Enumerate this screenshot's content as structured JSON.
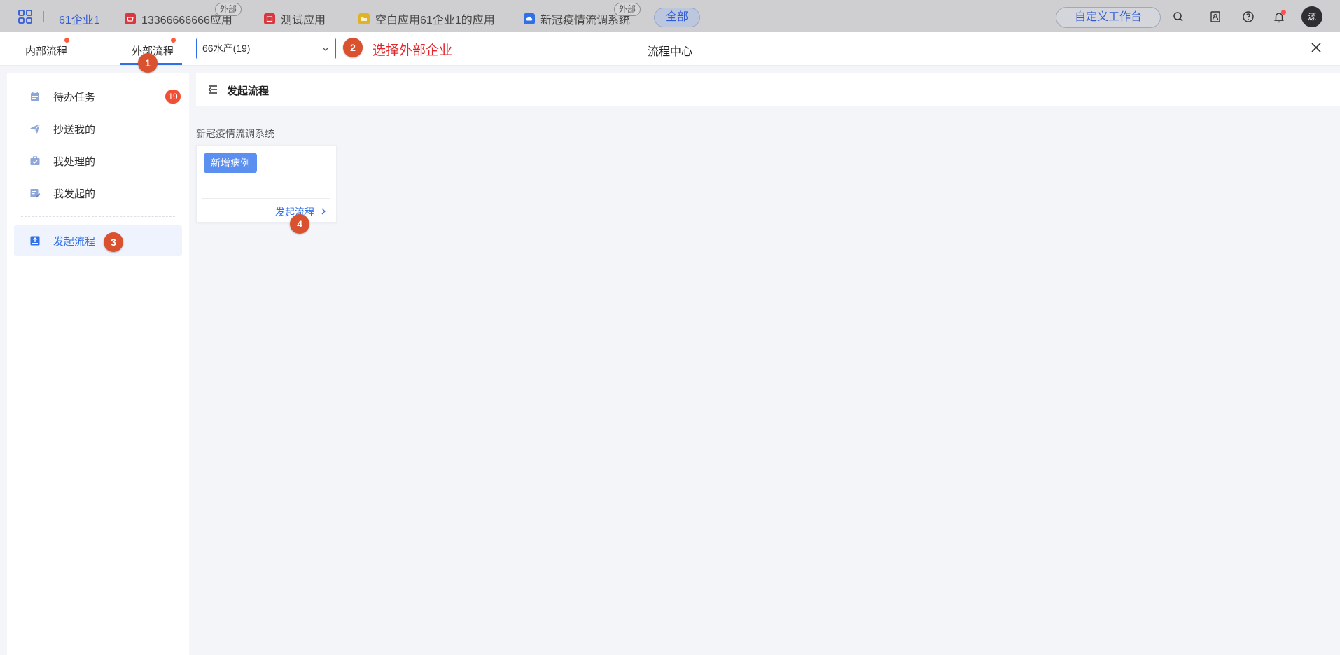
{
  "topbar": {
    "org_name": "61企业1",
    "apps": [
      {
        "label": "13366666666应用",
        "icon": "shop-icon",
        "color": "#d9363e",
        "external_badge": "外部"
      },
      {
        "label": "测试应用",
        "icon": "calendar-app-icon",
        "color": "#d9363e",
        "external_badge": ""
      },
      {
        "label": "空白应用61企业1的应用",
        "icon": "folder-app-icon",
        "color": "#e0b326",
        "external_badge": ""
      },
      {
        "label": "新冠疫情流调系统",
        "icon": "cloud-app-icon",
        "color": "#2f6fe8",
        "external_badge": "外部"
      }
    ],
    "all_label": "全部",
    "custom_workbench_label": "自定义工作台",
    "avatar_text": "源"
  },
  "subbar": {
    "tabs": [
      {
        "label": "内部流程",
        "active": false,
        "has_dot": true
      },
      {
        "label": "外部流程",
        "active": true,
        "has_dot": true
      }
    ],
    "company_select": {
      "value": "66水产(19)"
    },
    "select_hint": "选择外部企业",
    "title": "流程中心"
  },
  "steps": [
    "1",
    "2",
    "3",
    "4"
  ],
  "sidebar": {
    "items": [
      {
        "label": "待办任务",
        "icon": "todo-calendar-icon",
        "badge": "19",
        "active": false
      },
      {
        "label": "抄送我的",
        "icon": "paper-plane-icon",
        "badge": "",
        "active": false
      },
      {
        "label": "我处理的",
        "icon": "briefcase-check-icon",
        "badge": "",
        "active": false
      },
      {
        "label": "我发起的",
        "icon": "edit-doc-icon",
        "badge": "",
        "active": false
      },
      {
        "label": "发起流程",
        "icon": "start-flow-icon",
        "badge": "",
        "active": true
      }
    ]
  },
  "main": {
    "header_title": "发起流程",
    "group_label": "新冠疫情流调系统",
    "card": {
      "case_label": "新增病例",
      "start_link": "发起流程"
    }
  },
  "colors": {
    "accent": "#2f6fe8",
    "step_marker": "#d9512f",
    "hint_red": "#e3262b",
    "badge_red": "#f04e35"
  }
}
